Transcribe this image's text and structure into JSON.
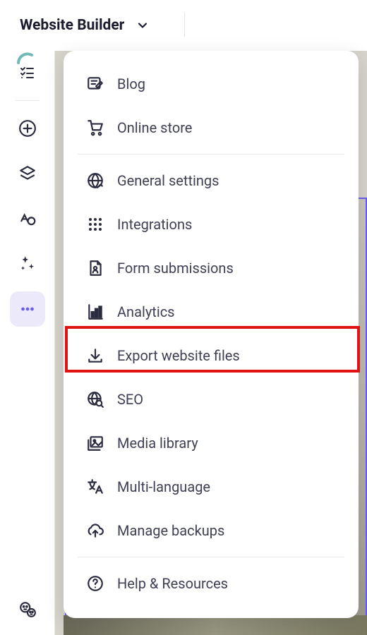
{
  "header": {
    "title": "Website Builder"
  },
  "menu": {
    "groups": [
      [
        {
          "id": "blog",
          "label": "Blog"
        },
        {
          "id": "online-store",
          "label": "Online store"
        }
      ],
      [
        {
          "id": "general-settings",
          "label": "General settings"
        },
        {
          "id": "integrations",
          "label": "Integrations"
        },
        {
          "id": "form-submissions",
          "label": "Form submissions"
        },
        {
          "id": "analytics",
          "label": "Analytics"
        },
        {
          "id": "export",
          "label": "Export website files"
        },
        {
          "id": "seo",
          "label": "SEO"
        },
        {
          "id": "media-library",
          "label": "Media library"
        },
        {
          "id": "multi-language",
          "label": "Multi-language"
        },
        {
          "id": "manage-backups",
          "label": "Manage backups"
        }
      ],
      [
        {
          "id": "help",
          "label": "Help & Resources"
        }
      ]
    ]
  },
  "highlighted_item": "export"
}
